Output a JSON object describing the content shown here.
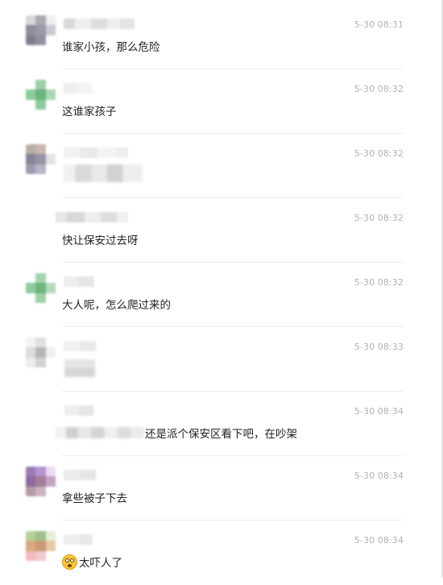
{
  "comments": [
    {
      "time": "5-30 08:31",
      "text": "谁家小孩，那么危险"
    },
    {
      "time": "5-30 08:32",
      "text": "这谁家孩子"
    },
    {
      "time": "5-30 08:32",
      "text": ""
    },
    {
      "time": "5-30 08:32",
      "text": "快让保安过去呀"
    },
    {
      "time": "5-30 08:32",
      "text": "大人呢，怎么爬过来的"
    },
    {
      "time": "5-30 08:33",
      "text": ""
    },
    {
      "time": "5-30 08:34",
      "text": "还是派个保安区看下吧，在吵架"
    },
    {
      "time": "5-30 08:34",
      "text": "拿些被子下去"
    },
    {
      "time": "5-30 08:34",
      "text": "太吓人了"
    }
  ],
  "icons": {
    "avatar": "blurred-avatar",
    "emoji": "shocked-face-icon"
  }
}
